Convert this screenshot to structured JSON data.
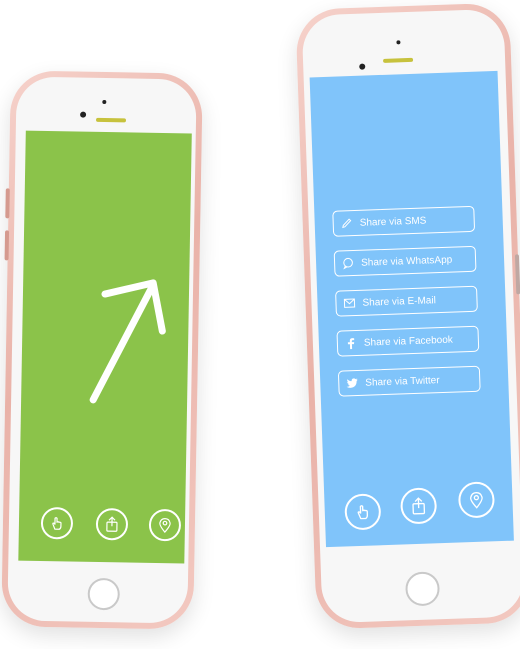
{
  "left_phone": {
    "screen_color": "#8bc34a",
    "content_icon": "arrow-up-right-icon",
    "nav": [
      {
        "icon": "tap-hand-icon"
      },
      {
        "icon": "share-icon"
      },
      {
        "icon": "location-pin-icon"
      }
    ]
  },
  "right_phone": {
    "screen_color": "#80c4fa",
    "share_options": [
      {
        "label": "Share via SMS",
        "icon": "pencil-icon"
      },
      {
        "label": "Share via WhatsApp",
        "icon": "chat-bubble-icon"
      },
      {
        "label": "Share via E-Mail",
        "icon": "envelope-icon"
      },
      {
        "label": "Share via Facebook",
        "icon": "facebook-icon"
      },
      {
        "label": "Share via Twitter",
        "icon": "twitter-icon"
      }
    ],
    "nav": [
      {
        "icon": "tap-hand-icon"
      },
      {
        "icon": "share-icon"
      },
      {
        "icon": "location-pin-icon"
      }
    ]
  },
  "colors": {
    "phone_body": "#efc2b9",
    "screen_green": "#8bc34a",
    "screen_blue": "#80c4fa",
    "icon_stroke": "#ffffff"
  }
}
